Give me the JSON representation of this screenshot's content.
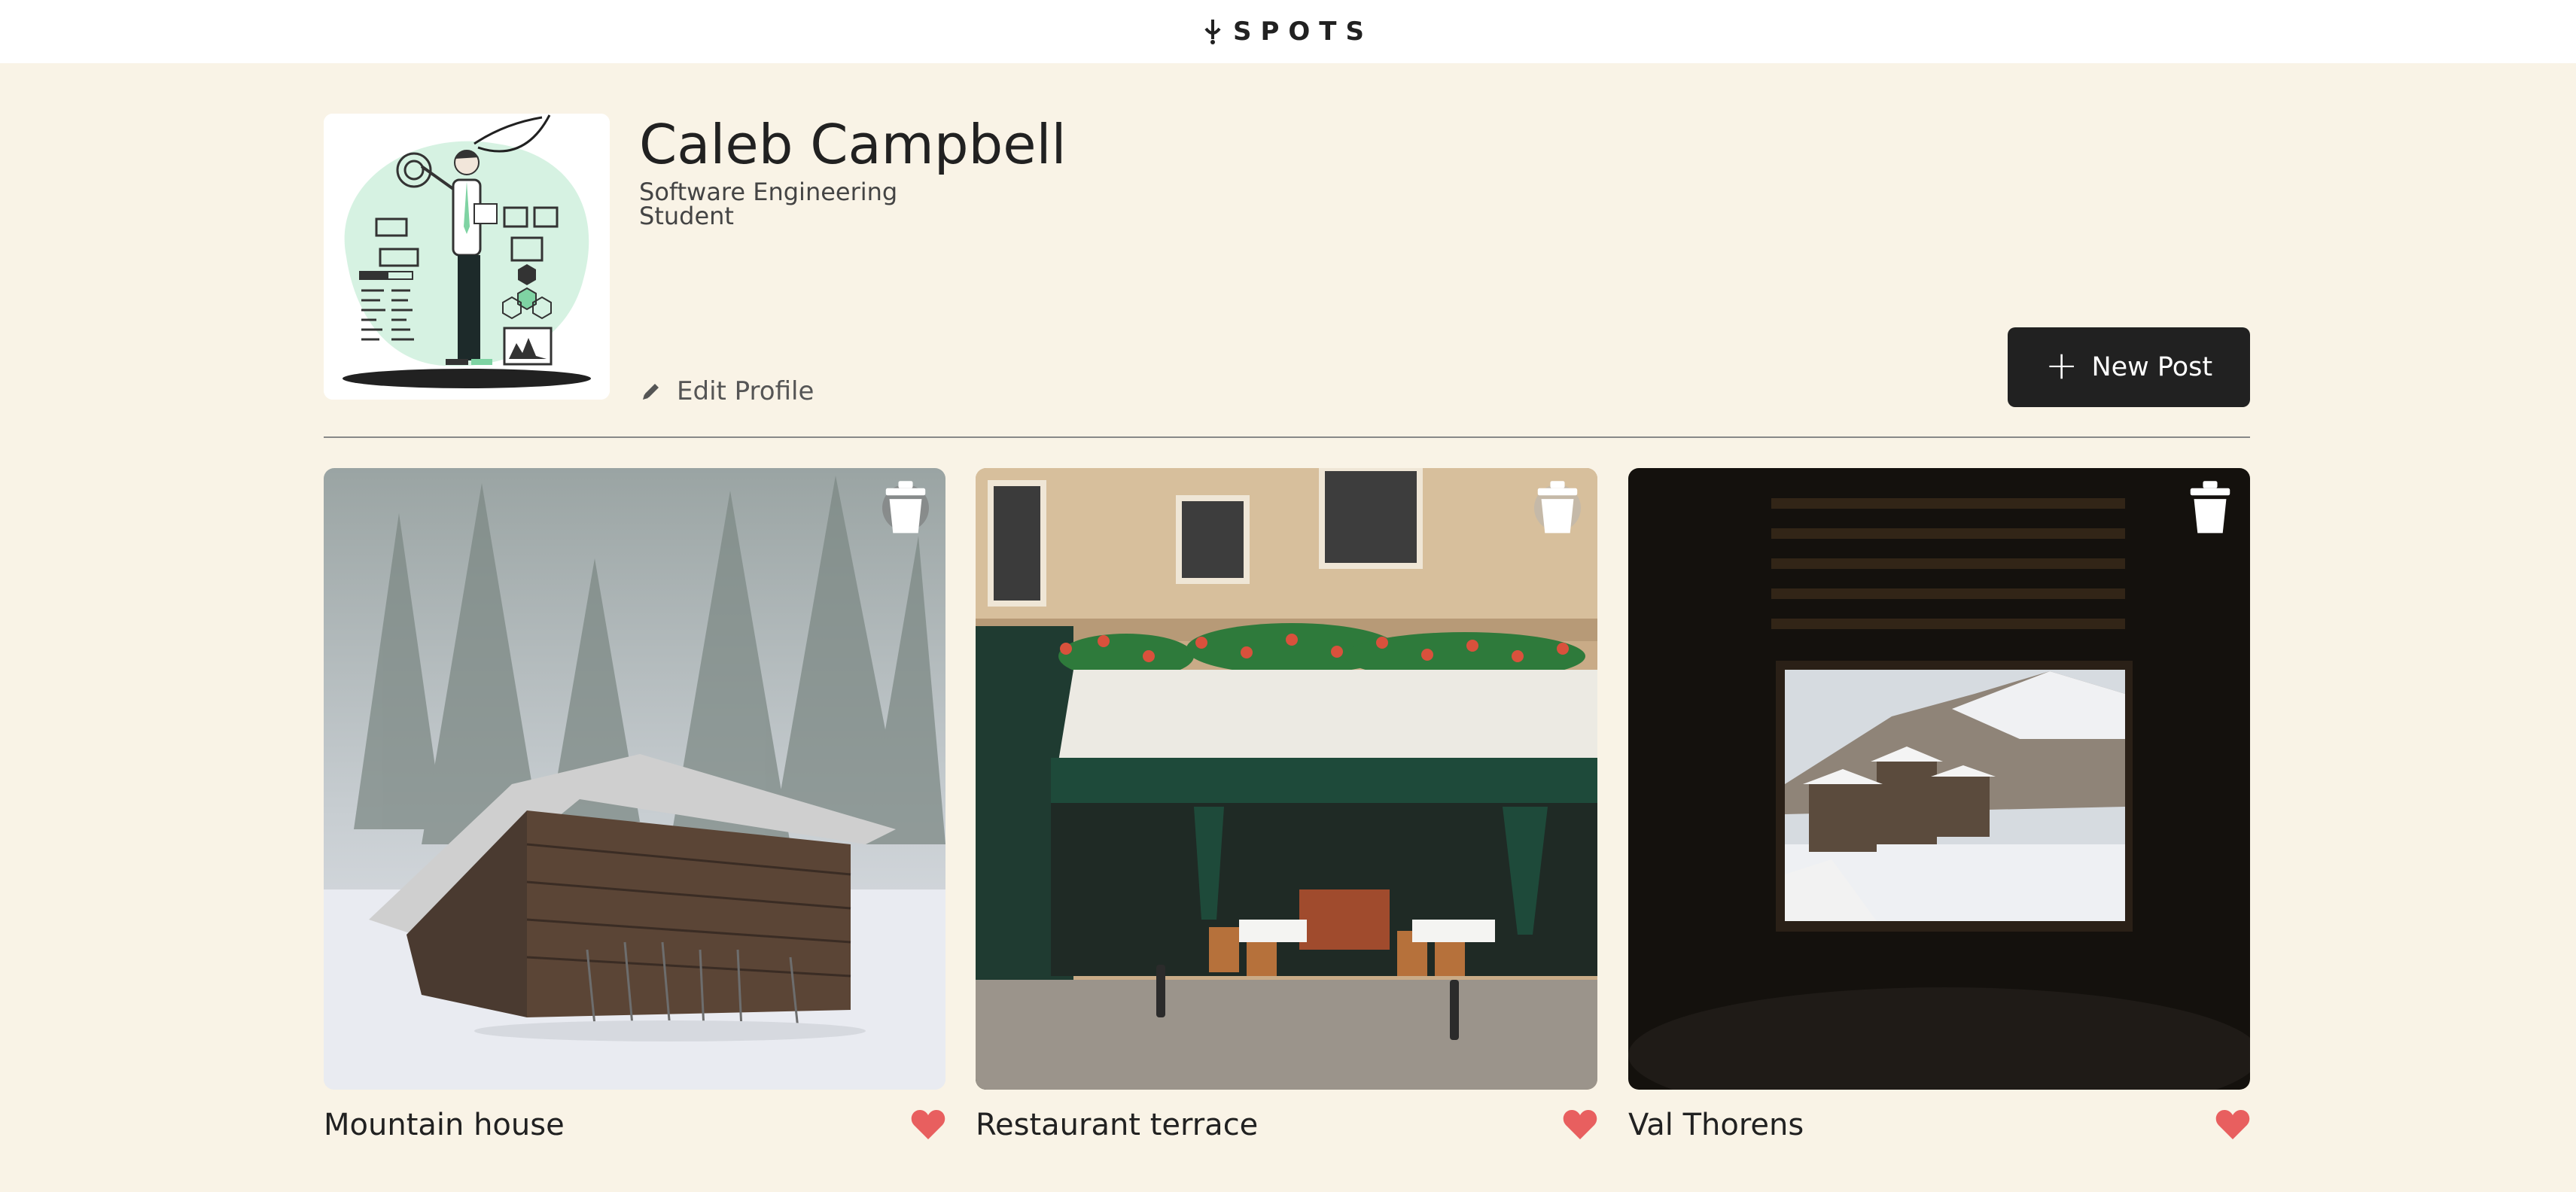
{
  "header": {
    "logo_text": "SPOTS",
    "logo_icon": "spots-logo-icon"
  },
  "profile": {
    "name": "Caleb Campbell",
    "job": "Software Engineering Student",
    "edit_label": "Edit Profile",
    "new_post_label": "New Post",
    "avatar_icon": "avatar-illustration"
  },
  "cards": [
    {
      "title": "Mountain house",
      "liked": true
    },
    {
      "title": "Restaurant terrace",
      "liked": true
    },
    {
      "title": "Val Thorens",
      "liked": true
    }
  ],
  "colors": {
    "page_bg": "#f9f3e6",
    "header_bg": "#ffffff",
    "text": "#212121",
    "heart": "#e85f5f",
    "button_bg": "#212121"
  }
}
